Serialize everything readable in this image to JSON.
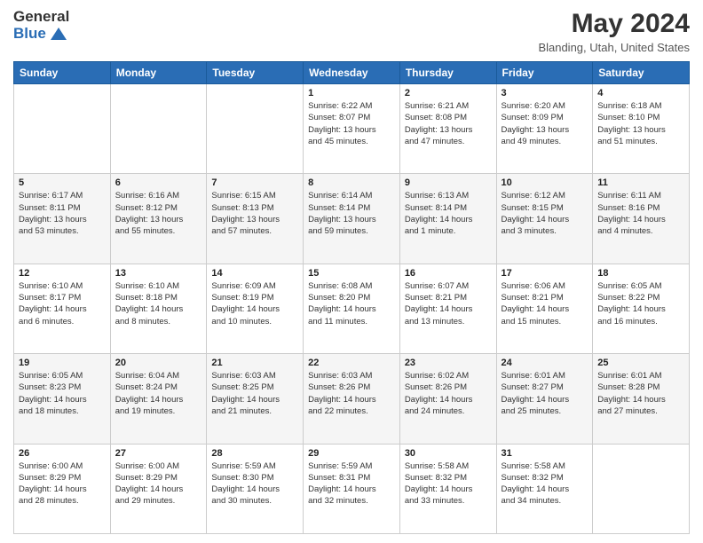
{
  "logo": {
    "text_general": "General",
    "text_blue": "Blue"
  },
  "header": {
    "title": "May 2024",
    "location": "Blanding, Utah, United States"
  },
  "days_of_week": [
    "Sunday",
    "Monday",
    "Tuesday",
    "Wednesday",
    "Thursday",
    "Friday",
    "Saturday"
  ],
  "weeks": [
    [
      {
        "day": "",
        "info": ""
      },
      {
        "day": "",
        "info": ""
      },
      {
        "day": "",
        "info": ""
      },
      {
        "day": "1",
        "info": "Sunrise: 6:22 AM\nSunset: 8:07 PM\nDaylight: 13 hours\nand 45 minutes."
      },
      {
        "day": "2",
        "info": "Sunrise: 6:21 AM\nSunset: 8:08 PM\nDaylight: 13 hours\nand 47 minutes."
      },
      {
        "day": "3",
        "info": "Sunrise: 6:20 AM\nSunset: 8:09 PM\nDaylight: 13 hours\nand 49 minutes."
      },
      {
        "day": "4",
        "info": "Sunrise: 6:18 AM\nSunset: 8:10 PM\nDaylight: 13 hours\nand 51 minutes."
      }
    ],
    [
      {
        "day": "5",
        "info": "Sunrise: 6:17 AM\nSunset: 8:11 PM\nDaylight: 13 hours\nand 53 minutes."
      },
      {
        "day": "6",
        "info": "Sunrise: 6:16 AM\nSunset: 8:12 PM\nDaylight: 13 hours\nand 55 minutes."
      },
      {
        "day": "7",
        "info": "Sunrise: 6:15 AM\nSunset: 8:13 PM\nDaylight: 13 hours\nand 57 minutes."
      },
      {
        "day": "8",
        "info": "Sunrise: 6:14 AM\nSunset: 8:14 PM\nDaylight: 13 hours\nand 59 minutes."
      },
      {
        "day": "9",
        "info": "Sunrise: 6:13 AM\nSunset: 8:14 PM\nDaylight: 14 hours\nand 1 minute."
      },
      {
        "day": "10",
        "info": "Sunrise: 6:12 AM\nSunset: 8:15 PM\nDaylight: 14 hours\nand 3 minutes."
      },
      {
        "day": "11",
        "info": "Sunrise: 6:11 AM\nSunset: 8:16 PM\nDaylight: 14 hours\nand 4 minutes."
      }
    ],
    [
      {
        "day": "12",
        "info": "Sunrise: 6:10 AM\nSunset: 8:17 PM\nDaylight: 14 hours\nand 6 minutes."
      },
      {
        "day": "13",
        "info": "Sunrise: 6:10 AM\nSunset: 8:18 PM\nDaylight: 14 hours\nand 8 minutes."
      },
      {
        "day": "14",
        "info": "Sunrise: 6:09 AM\nSunset: 8:19 PM\nDaylight: 14 hours\nand 10 minutes."
      },
      {
        "day": "15",
        "info": "Sunrise: 6:08 AM\nSunset: 8:20 PM\nDaylight: 14 hours\nand 11 minutes."
      },
      {
        "day": "16",
        "info": "Sunrise: 6:07 AM\nSunset: 8:21 PM\nDaylight: 14 hours\nand 13 minutes."
      },
      {
        "day": "17",
        "info": "Sunrise: 6:06 AM\nSunset: 8:21 PM\nDaylight: 14 hours\nand 15 minutes."
      },
      {
        "day": "18",
        "info": "Sunrise: 6:05 AM\nSunset: 8:22 PM\nDaylight: 14 hours\nand 16 minutes."
      }
    ],
    [
      {
        "day": "19",
        "info": "Sunrise: 6:05 AM\nSunset: 8:23 PM\nDaylight: 14 hours\nand 18 minutes."
      },
      {
        "day": "20",
        "info": "Sunrise: 6:04 AM\nSunset: 8:24 PM\nDaylight: 14 hours\nand 19 minutes."
      },
      {
        "day": "21",
        "info": "Sunrise: 6:03 AM\nSunset: 8:25 PM\nDaylight: 14 hours\nand 21 minutes."
      },
      {
        "day": "22",
        "info": "Sunrise: 6:03 AM\nSunset: 8:26 PM\nDaylight: 14 hours\nand 22 minutes."
      },
      {
        "day": "23",
        "info": "Sunrise: 6:02 AM\nSunset: 8:26 PM\nDaylight: 14 hours\nand 24 minutes."
      },
      {
        "day": "24",
        "info": "Sunrise: 6:01 AM\nSunset: 8:27 PM\nDaylight: 14 hours\nand 25 minutes."
      },
      {
        "day": "25",
        "info": "Sunrise: 6:01 AM\nSunset: 8:28 PM\nDaylight: 14 hours\nand 27 minutes."
      }
    ],
    [
      {
        "day": "26",
        "info": "Sunrise: 6:00 AM\nSunset: 8:29 PM\nDaylight: 14 hours\nand 28 minutes."
      },
      {
        "day": "27",
        "info": "Sunrise: 6:00 AM\nSunset: 8:29 PM\nDaylight: 14 hours\nand 29 minutes."
      },
      {
        "day": "28",
        "info": "Sunrise: 5:59 AM\nSunset: 8:30 PM\nDaylight: 14 hours\nand 30 minutes."
      },
      {
        "day": "29",
        "info": "Sunrise: 5:59 AM\nSunset: 8:31 PM\nDaylight: 14 hours\nand 32 minutes."
      },
      {
        "day": "30",
        "info": "Sunrise: 5:58 AM\nSunset: 8:32 PM\nDaylight: 14 hours\nand 33 minutes."
      },
      {
        "day": "31",
        "info": "Sunrise: 5:58 AM\nSunset: 8:32 PM\nDaylight: 14 hours\nand 34 minutes."
      },
      {
        "day": "",
        "info": ""
      }
    ]
  ],
  "colors": {
    "header_bg": "#2a6db5",
    "header_text": "#ffffff",
    "border": "#cccccc"
  }
}
